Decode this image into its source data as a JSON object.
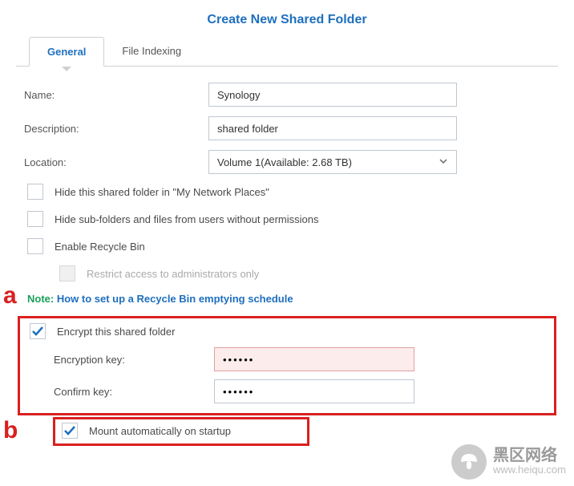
{
  "title": "Create New Shared Folder",
  "tabs": {
    "general": "General",
    "file_indexing": "File Indexing"
  },
  "labels": {
    "name": "Name:",
    "description": "Description:",
    "location": "Location:"
  },
  "fields": {
    "name_value": "Synology",
    "description_value": "shared folder",
    "location_value": "Volume 1(Available: 2.68 TB)"
  },
  "checkboxes": {
    "hide_network": "Hide this shared folder in \"My Network Places\"",
    "hide_sub": "Hide sub-folders and files from users without permissions",
    "recycle": "Enable Recycle Bin",
    "restrict_admin": "Restrict access to administrators only",
    "encrypt": "Encrypt this shared folder",
    "mount": "Mount automatically on startup"
  },
  "note": {
    "prefix": "Note: ",
    "link": "How to set up a Recycle Bin emptying schedule"
  },
  "encryption": {
    "key_label": "Encryption key:",
    "confirm_label": "Confirm key:",
    "key_value": "••••••",
    "confirm_value": "••••••"
  },
  "callouts": {
    "a": "a",
    "b": "b"
  },
  "watermark": {
    "main": "黑区网络",
    "sub": "www.heiqu.com"
  }
}
